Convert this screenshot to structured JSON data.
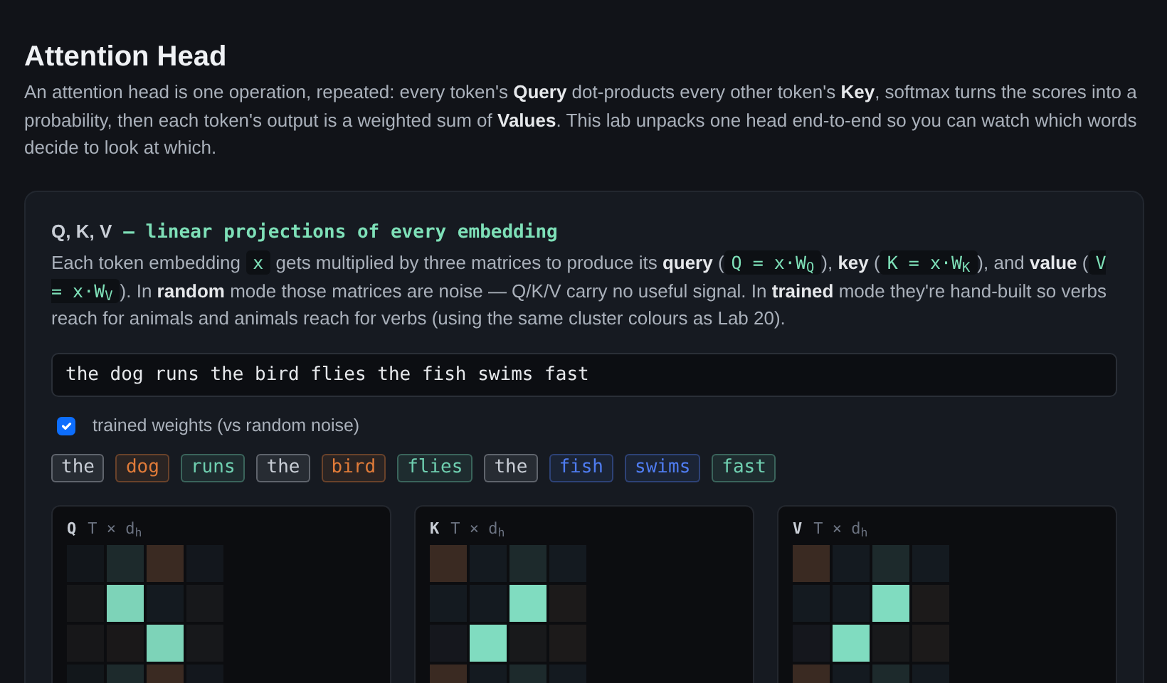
{
  "title": "Attention Head",
  "intro": "An attention head is one operation, repeated: every token's **Query** dot-products every other token's **Key**, softmax turns the scores into a probability, then each token's output is a weighted sum of **Values**. This lab unpacks one head end-to-end so you can watch which words decide to look at which.",
  "section": {
    "heading": "Q, K, V",
    "subheading": "— linear projections of every embedding",
    "description": [
      {
        "kind": "text",
        "text": "Each token embedding "
      },
      {
        "kind": "code",
        "text": "x"
      },
      {
        "kind": "text",
        "text": " gets multiplied by three matrices to produce its **query** ("
      },
      {
        "kind": "code",
        "text": "Q = x·W$_{Q}$"
      },
      {
        "kind": "text",
        "text": "), **key** ("
      },
      {
        "kind": "code",
        "text": "K = x·W$_{K}$"
      },
      {
        "kind": "text",
        "text": "), and **value** ("
      },
      {
        "kind": "code",
        "text": "V = x·W$_{V}$"
      },
      {
        "kind": "text",
        "text": "). In **random** mode those matrices are noise — Q/K/V carry no useful signal. In **trained** mode they're hand-built so verbs reach for animals and animals reach for verbs (using the same cluster colours as Lab 20)."
      }
    ],
    "sentence_input": {
      "value": "the dog runs the bird flies the fish swims fast"
    },
    "trained_weights": {
      "label": "trained weights (vs random noise)",
      "checked": true
    },
    "tokens": [
      {
        "text": "the",
        "color": "#c9ced6"
      },
      {
        "text": "dog",
        "color": "#e07b39"
      },
      {
        "text": "runs",
        "color": "#6fcfb0"
      },
      {
        "text": "the",
        "color": "#c9ced6"
      },
      {
        "text": "bird",
        "color": "#e07b39"
      },
      {
        "text": "flies",
        "color": "#6fcfb0"
      },
      {
        "text": "the",
        "color": "#c9ced6"
      },
      {
        "text": "fish",
        "color": "#4f7cf0"
      },
      {
        "text": "swims",
        "color": "#4f7cf0"
      },
      {
        "text": "fast",
        "color": "#6fcfb0"
      }
    ],
    "matrices": [
      {
        "name": "Q",
        "shape": "T × d$_{h}$",
        "rows": [
          [
            {
              "color": "#12161b"
            },
            {
              "color": "#1d2a2c"
            },
            {
              "color": "#3a2a22"
            },
            {
              "color": "#13171d"
            }
          ],
          [
            {
              "color": "#161719"
            },
            {
              "color": "#7dd3b8"
            },
            {
              "color": "#141a20"
            },
            {
              "color": "#17181b"
            }
          ],
          [
            {
              "color": "#171719"
            },
            {
              "color": "#1a1819"
            },
            {
              "color": "#7dd3b8"
            },
            {
              "color": "#17181b"
            }
          ],
          [
            {
              "color": "#12171b"
            },
            {
              "color": "#1d2a2c"
            },
            {
              "color": "#3a2a22"
            },
            {
              "color": "#13171d"
            }
          ]
        ]
      },
      {
        "name": "K",
        "shape": "T × d$_{h}$",
        "rows": [
          [
            {
              "color": "#3a2a22"
            },
            {
              "color": "#141a20"
            },
            {
              "color": "#1d2a2c"
            },
            {
              "color": "#141a20"
            }
          ],
          [
            {
              "color": "#141a20"
            },
            {
              "color": "#141a20"
            },
            {
              "color": "#80dcc0"
            },
            {
              "color": "#1c1a1a"
            }
          ],
          [
            {
              "color": "#15171d"
            },
            {
              "color": "#80dcc0"
            },
            {
              "color": "#18191b"
            },
            {
              "color": "#1c1a1a"
            }
          ],
          [
            {
              "color": "#3a2a22"
            },
            {
              "color": "#141a20"
            },
            {
              "color": "#1d2a2c"
            },
            {
              "color": "#141a20"
            }
          ]
        ]
      },
      {
        "name": "V",
        "shape": "T × d$_{h}$",
        "rows": [
          [
            {
              "color": "#3a2a22"
            },
            {
              "color": "#141a20"
            },
            {
              "color": "#1d2a2c"
            },
            {
              "color": "#141a20"
            }
          ],
          [
            {
              "color": "#141a20"
            },
            {
              "color": "#141a20"
            },
            {
              "color": "#80dcc0"
            },
            {
              "color": "#1c1a1a"
            }
          ],
          [
            {
              "color": "#15171d"
            },
            {
              "color": "#80dcc0"
            },
            {
              "color": "#18191b"
            },
            {
              "color": "#1c1a1a"
            }
          ],
          [
            {
              "color": "#3a2a22"
            },
            {
              "color": "#141a20"
            },
            {
              "color": "#1d2a2c"
            },
            {
              "color": "#141a20"
            }
          ]
        ]
      }
    ]
  }
}
